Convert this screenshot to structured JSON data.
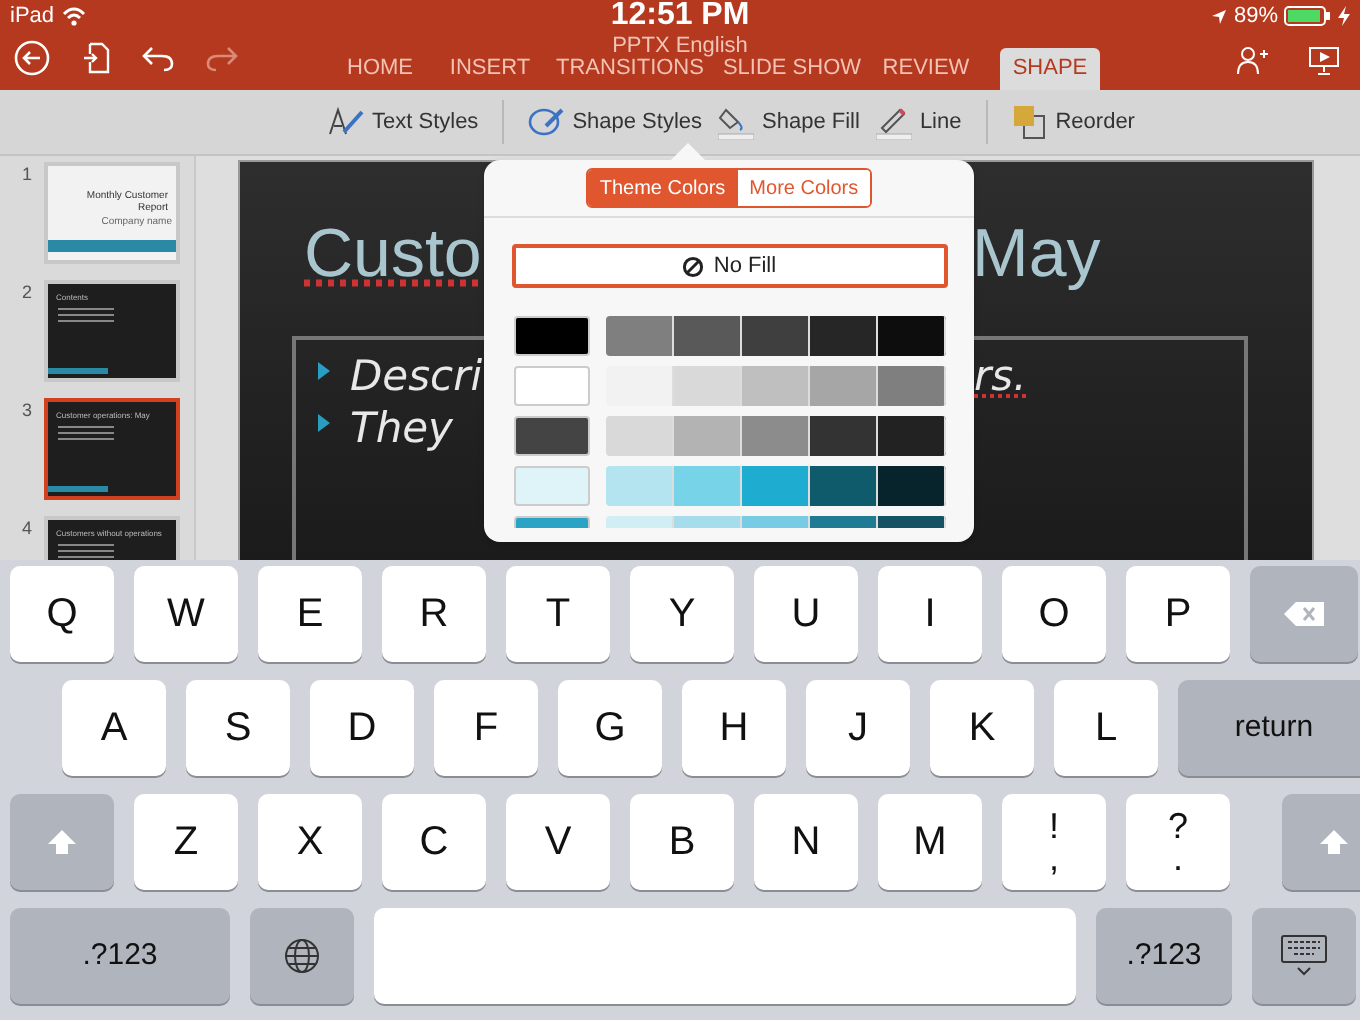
{
  "status_bar": {
    "device": "iPad",
    "time": "12:51 PM",
    "battery": "89%"
  },
  "window": {
    "title": "PPTX English"
  },
  "tabs": [
    {
      "label": "HOME",
      "selected": false
    },
    {
      "label": "INSERT",
      "selected": false
    },
    {
      "label": "TRANSITIONS",
      "selected": false
    },
    {
      "label": "SLIDE SHOW",
      "selected": false
    },
    {
      "label": "REVIEW",
      "selected": false
    },
    {
      "label": "SHAPE",
      "selected": true
    }
  ],
  "toolbar": [
    {
      "kind": "text-styles",
      "label": "Text Styles"
    },
    {
      "kind": "shape-styles",
      "label": "Shape Styles"
    },
    {
      "kind": "shape-fill",
      "label": "Shape Fill"
    },
    {
      "kind": "line",
      "label": "Line"
    },
    {
      "kind": "reorder",
      "label": "Reorder"
    }
  ],
  "thumbnails": [
    {
      "number": "1",
      "kind": "title",
      "title": "Monthly Customer Report",
      "subtitle": "Company name",
      "selected": false
    },
    {
      "number": "2",
      "kind": "dark",
      "title": "Contents",
      "selected": false
    },
    {
      "number": "3",
      "kind": "dark",
      "title": "Customer operations: May",
      "selected": true
    },
    {
      "number": "4",
      "kind": "dark",
      "title": "Customers without operations",
      "selected": false
    }
  ],
  "slide": {
    "title_left": "Custo",
    "title_right": "May",
    "bullets": [
      "Descri",
      "They"
    ],
    "bullet_end": "rs."
  },
  "popover": {
    "segments": [
      {
        "label": "Theme Colors",
        "selected": true
      },
      {
        "label": "More Colors",
        "selected": false
      }
    ],
    "no_fill": "No Fill",
    "palette": [
      {
        "base": {
          "color": "#000000"
        },
        "shades": [
          {
            "color": "#7f7f7f"
          },
          {
            "color": "#595959"
          },
          {
            "color": "#3f3f3f"
          },
          {
            "color": "#262626"
          },
          {
            "color": "#0d0d0d"
          }
        ]
      },
      {
        "base": {
          "color": "#ffffff"
        },
        "shades": [
          {
            "color": "#f2f2f2"
          },
          {
            "color": "#d9d9d9"
          },
          {
            "color": "#bfbfbf"
          },
          {
            "color": "#a6a6a6"
          },
          {
            "color": "#7f7f7f"
          }
        ]
      },
      {
        "base": {
          "color": "#444444"
        },
        "shades": [
          {
            "color": "#d9d9d9"
          },
          {
            "color": "#b3b3b3"
          },
          {
            "color": "#8c8c8c"
          },
          {
            "color": "#333333"
          },
          {
            "color": "#222222"
          }
        ]
      },
      {
        "base": {
          "color": "#dff4f9"
        },
        "shades": [
          {
            "color": "#b3e4f0"
          },
          {
            "color": "#77d3e8"
          },
          {
            "color": "#1eacd0"
          },
          {
            "color": "#0f5b6c"
          },
          {
            "color": "#07232b"
          }
        ]
      },
      {
        "base": {
          "color": "#2aa3c4"
        },
        "shades": [
          {
            "color": "#d2eef5"
          },
          {
            "color": "#a5dded"
          },
          {
            "color": "#77cbe2"
          },
          {
            "color": "#1f7b93"
          },
          {
            "color": "#155264"
          }
        ]
      }
    ]
  },
  "keyboard": [
    [
      {
        "kind": "letter",
        "label": "Q"
      },
      {
        "kind": "letter",
        "label": "W"
      },
      {
        "kind": "letter",
        "label": "E"
      },
      {
        "kind": "letter",
        "label": "R"
      },
      {
        "kind": "letter",
        "label": "T"
      },
      {
        "kind": "letter",
        "label": "Y"
      },
      {
        "kind": "letter",
        "label": "U"
      },
      {
        "kind": "letter",
        "label": "I"
      },
      {
        "kind": "letter",
        "label": "O"
      },
      {
        "kind": "letter",
        "label": "P"
      },
      {
        "kind": "backspace"
      }
    ],
    [
      {
        "kind": "letter",
        "label": "A"
      },
      {
        "kind": "letter",
        "label": "S"
      },
      {
        "kind": "letter",
        "label": "D"
      },
      {
        "kind": "letter",
        "label": "F"
      },
      {
        "kind": "letter",
        "label": "G"
      },
      {
        "kind": "letter",
        "label": "H"
      },
      {
        "kind": "letter",
        "label": "J"
      },
      {
        "kind": "letter",
        "label": "K"
      },
      {
        "kind": "letter",
        "label": "L"
      },
      {
        "kind": "return",
        "label": "return"
      }
    ],
    [
      {
        "kind": "shift"
      },
      {
        "kind": "letter",
        "label": "Z"
      },
      {
        "kind": "letter",
        "label": "X"
      },
      {
        "kind": "letter",
        "label": "C"
      },
      {
        "kind": "letter",
        "label": "V"
      },
      {
        "kind": "letter",
        "label": "B"
      },
      {
        "kind": "letter",
        "label": "N"
      },
      {
        "kind": "letter",
        "label": "M"
      },
      {
        "kind": "pair",
        "top": "!",
        "bottom": ","
      },
      {
        "kind": "pair",
        "top": "?",
        "bottom": "."
      },
      {
        "kind": "shift"
      }
    ],
    [
      {
        "kind": "numbers",
        "label": ".?123"
      },
      {
        "kind": "globe"
      },
      {
        "kind": "space"
      },
      {
        "kind": "numbers",
        "label": ".?123"
      },
      {
        "kind": "hide"
      }
    ]
  ]
}
